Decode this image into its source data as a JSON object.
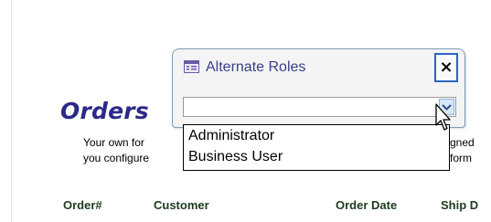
{
  "page": {
    "title": "Orders",
    "description_line1": "Your own for",
    "description_line1_tail": "gned",
    "description_line2": "you configure",
    "description_line2_tail": "form"
  },
  "table": {
    "columns": [
      "Order#",
      "Customer",
      "Order Date",
      "Ship D"
    ]
  },
  "dialog": {
    "icon": "form-icon",
    "title": "Alternate Roles",
    "close_label": "×",
    "combo_value": "",
    "options": [
      "Administrator",
      "Business User"
    ]
  },
  "colors": {
    "title": "#2b2a88",
    "dialog_title": "#383e88",
    "column_header": "#1e3b1e",
    "focus_border": "#2a65c5"
  }
}
